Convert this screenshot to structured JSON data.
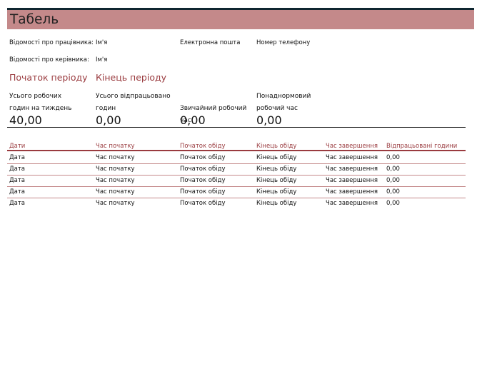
{
  "title": "Табель",
  "employee": {
    "label": "Відомості про працівника:",
    "name": "Ім'я",
    "email": "Електронна пошта",
    "phone": "Номер телефону"
  },
  "manager": {
    "label": "Відомості про керівника:",
    "name": "Ім'я"
  },
  "period": {
    "start": "Початок періоду",
    "end": "Кінець періоду"
  },
  "summary": {
    "total_hours_label": "Усього робочих годин на тиждень",
    "total_hours_value": "40,00",
    "worked_label": "Усього відпрацьовано годин",
    "worked_value": "0,00",
    "regular_label": "Звичайний робочий час",
    "regular_value": "0,00",
    "overtime_label": "Понаднормовий робочий час",
    "overtime_value": "0,00"
  },
  "table": {
    "headers": [
      "Дати",
      "Час початку",
      "Початок обіду",
      "Кінець обіду",
      "Час завершення",
      "Відпрацьовані години"
    ],
    "rows": [
      [
        "Дата",
        "Час початку",
        "Початок обіду",
        "Кінець обіду",
        "Час завершення",
        "0,00"
      ],
      [
        "Дата",
        "Час початку",
        "Початок обіду",
        "Кінець обіду",
        "Час завершення",
        "0,00"
      ],
      [
        "Дата",
        "Час початку",
        "Початок обіду",
        "Кінець обіду",
        "Час завершення",
        "0,00"
      ],
      [
        "Дата",
        "Час початку",
        "Початок обіду",
        "Кінець обіду",
        "Час завершення",
        "0,00"
      ],
      [
        "Дата",
        "Час початку",
        "Початок обіду",
        "Кінець обіду",
        "Час завершення",
        "0,00"
      ]
    ]
  },
  "colors": {
    "title_bg": "#c4898a",
    "accent": "#9a3b3f",
    "title_border": "#0f2630"
  }
}
